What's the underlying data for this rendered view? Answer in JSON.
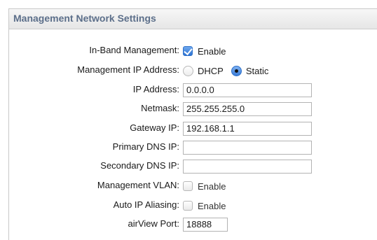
{
  "section": {
    "title": "Management Network Settings"
  },
  "in_band": {
    "label": "In-Band Management:",
    "option": "Enable",
    "checked": true
  },
  "mgmt_ip": {
    "label": "Management IP Address:",
    "dhcp": "DHCP",
    "static": "Static",
    "selected": "Static"
  },
  "ip_address": {
    "label": "IP Address:",
    "value": "0.0.0.0"
  },
  "netmask": {
    "label": "Netmask:",
    "value": "255.255.255.0"
  },
  "gateway": {
    "label": "Gateway IP:",
    "value": "192.168.1.1"
  },
  "primary_dns": {
    "label": "Primary DNS IP:",
    "value": ""
  },
  "secondary_dns": {
    "label": "Secondary DNS IP:",
    "value": ""
  },
  "mgmt_vlan": {
    "label": "Management VLAN:",
    "option": "Enable",
    "checked": false
  },
  "auto_ip_alias": {
    "label": "Auto IP Aliasing:",
    "option": "Enable",
    "checked": false
  },
  "airview_port": {
    "label": "airView Port:",
    "value": "18888"
  },
  "colors": {
    "header_text": "#5c6f8a",
    "accent": "#2f74d3",
    "border": "#b3b3b3"
  }
}
